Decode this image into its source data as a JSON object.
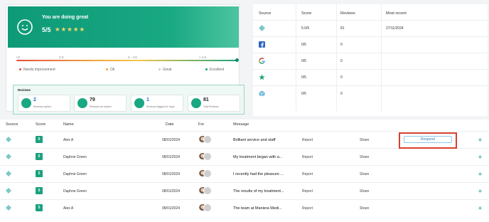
{
  "summary": {
    "title": "You are doing great",
    "rating": "5/5",
    "stars": "★★★★★",
    "scale_labels": [
      "<2",
      "2-3",
      "3 - 4.5",
      "> 4.5"
    ],
    "legend": [
      {
        "label": "Needs improvement",
        "color": "#e74c3c"
      },
      {
        "label": "Ok",
        "color": "#f1a33c"
      },
      {
        "label": "Great",
        "color": "#c8cbd0"
      },
      {
        "label": "Excellent",
        "color": "#1aa17d"
      }
    ],
    "reviews_title": "Reviews",
    "stats": [
      {
        "value": "2",
        "label": "Reviews replied"
      },
      {
        "value": "79",
        "label": "Reviews not replied"
      },
      {
        "value": "1",
        "label": "Reviews flagged for reply"
      },
      {
        "value": "81",
        "label": "Total Reviews"
      }
    ]
  },
  "sources": {
    "headers": [
      "Source",
      "Score",
      "Reviews",
      "Most recent"
    ],
    "rows": [
      {
        "icon": "diamond-icon",
        "score": "5.0/5",
        "reviews": "81",
        "recent": "27/11/2024"
      },
      {
        "icon": "facebook-icon",
        "score": "0/5",
        "reviews": "0",
        "recent": ""
      },
      {
        "icon": "google-icon",
        "score": "0/5",
        "reviews": "0",
        "recent": ""
      },
      {
        "icon": "trustpilot-star-icon",
        "score": "0/5",
        "reviews": "0",
        "recent": ""
      },
      {
        "icon": "cube-icon",
        "score": "0/5",
        "reviews": "0",
        "recent": ""
      }
    ]
  },
  "reviews_table": {
    "headers": [
      "Source",
      "Score",
      "Name",
      "Date",
      "For",
      "Message"
    ],
    "rows": [
      {
        "score": "5",
        "name": "Alex A",
        "date": "08/01/2024",
        "message": "Brilliant service and staff",
        "report": "Report",
        "share": "Share",
        "respond": "Respond"
      },
      {
        "score": "5",
        "name": "Daphne Green",
        "date": "08/01/2024",
        "message": "My treatment began with a...",
        "report": "Report",
        "share": "Share",
        "respond": ""
      },
      {
        "score": "5",
        "name": "Daphne Green",
        "date": "08/01/2024",
        "message": "I recently had the pleasure ...",
        "report": "Report",
        "share": "Share",
        "respond": ""
      },
      {
        "score": "5",
        "name": "Daphne Green",
        "date": "08/01/2024",
        "message": "The results of my treatment...",
        "report": "Report",
        "share": "Share",
        "respond": ""
      },
      {
        "score": "5",
        "name": "Alex A",
        "date": "08/01/2024",
        "message": "The team at Maniera Medi...",
        "report": "Report",
        "share": "Share",
        "respond": ""
      }
    ]
  },
  "colors": {
    "accent": "#1aa17d",
    "highlight": "#d6402f"
  }
}
